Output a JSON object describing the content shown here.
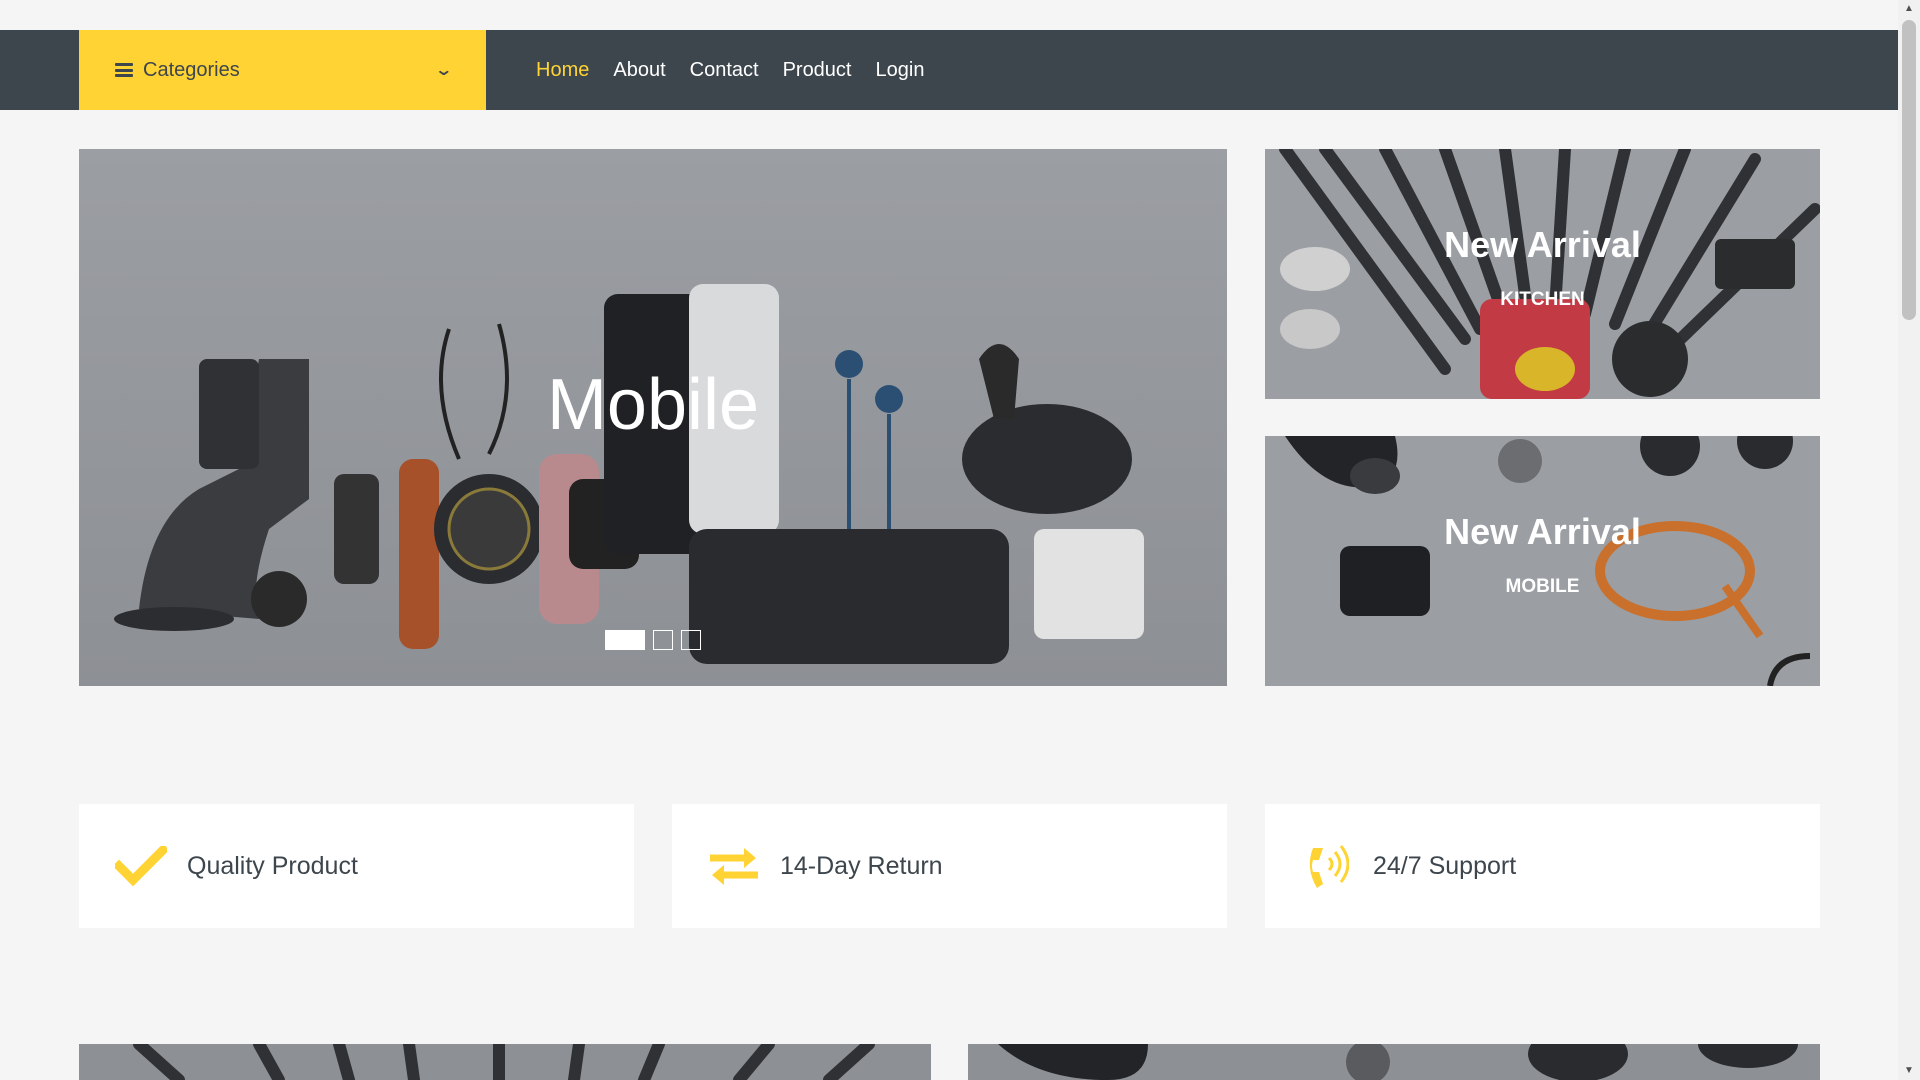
{
  "navbar": {
    "categories_label": "Categories",
    "links": [
      {
        "label": "Home",
        "active": true
      },
      {
        "label": "About",
        "active": false
      },
      {
        "label": "Contact",
        "active": false
      },
      {
        "label": "Product",
        "active": false
      },
      {
        "label": "Login",
        "active": false
      }
    ]
  },
  "hero": {
    "title": "Mobile",
    "slide_count": 3,
    "active_slide": 1
  },
  "promos": [
    {
      "title": "New Arrival",
      "subtitle": "KITCHEN"
    },
    {
      "title": "New Arrival",
      "subtitle": "MOBILE"
    }
  ],
  "features": [
    {
      "label": "Quality Product",
      "icon": "check-icon"
    },
    {
      "label": "14-Day Return",
      "icon": "exchange-icon"
    },
    {
      "label": "24/7 Support",
      "icon": "phone-volume-icon"
    }
  ],
  "colors": {
    "accent": "#ffd333",
    "dark": "#3d464d",
    "background": "#f5f5f5"
  }
}
